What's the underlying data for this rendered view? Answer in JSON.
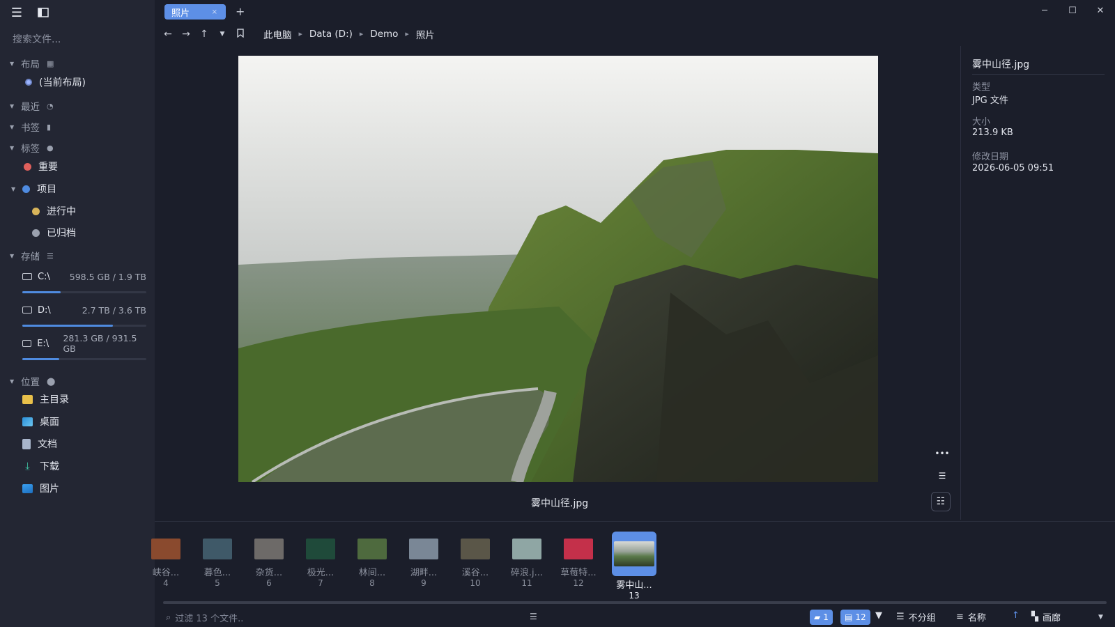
{
  "sidebar": {
    "search_placeholder": "搜索文件...",
    "layout": {
      "label": "布局",
      "current": "(当前布局)"
    },
    "recent": {
      "label": "最近"
    },
    "bookmarks": {
      "label": "书签"
    },
    "tags": {
      "label": "标签",
      "items": [
        {
          "label": "重要",
          "color": "#e0605c"
        },
        {
          "label": "项目",
          "color": "#4f8be0"
        },
        {
          "label": "进行中",
          "color": "#d8b45a"
        },
        {
          "label": "已归档",
          "color": "#9aa0ae"
        }
      ]
    },
    "storage": {
      "label": "存储",
      "drives": [
        {
          "name": "C:\\",
          "size": "598.5 GB / 1.9 TB",
          "usage": 0.31
        },
        {
          "name": "D:\\",
          "size": "2.7 TB / 3.6 TB",
          "usage": 0.73
        },
        {
          "name": "E:\\",
          "size": "281.3 GB / 931.5 GB",
          "usage": 0.3
        }
      ]
    },
    "places": {
      "label": "位置",
      "items": [
        {
          "label": "主目录",
          "icon": "folder-icon"
        },
        {
          "label": "桌面",
          "icon": "desktop-icon"
        },
        {
          "label": "文档",
          "icon": "document-icon"
        },
        {
          "label": "下载",
          "icon": "download-icon"
        },
        {
          "label": "图片",
          "icon": "picture-icon"
        }
      ]
    }
  },
  "tabs": [
    {
      "label": "照片",
      "close": "×"
    }
  ],
  "tab_add": "+",
  "breadcrumb": [
    "此电脑",
    "Data (D:)",
    "Demo",
    "照片"
  ],
  "viewer": {
    "caption": "雾中山径.jpg"
  },
  "info": {
    "filename": "雾中山径.jpg",
    "type_label": "类型",
    "type_value": "JPG 文件",
    "size_label": "大小",
    "size_value": "213.9 KB",
    "modified_label": "修改日期",
    "modified_value": "2026-06-05 09:51"
  },
  "filmstrip": [
    {
      "name": "峡谷...",
      "num": "4",
      "color": "#8a4a2e"
    },
    {
      "name": "暮色...",
      "num": "5",
      "color": "#3f5968"
    },
    {
      "name": "杂货...",
      "num": "6",
      "color": "#6d6a68"
    },
    {
      "name": "极光...",
      "num": "7",
      "color": "#1f4a3a"
    },
    {
      "name": "林间...",
      "num": "8",
      "color": "#4e6a3e"
    },
    {
      "name": "湖畔...",
      "num": "9",
      "color": "#7a8796"
    },
    {
      "name": "溪谷...",
      "num": "10",
      "color": "#5a5648"
    },
    {
      "name": "碎浪.j...",
      "num": "11",
      "color": "#8fa6a4"
    },
    {
      "name": "草莓特...",
      "num": "12",
      "color": "#c4304a"
    },
    {
      "name": "雾中山...",
      "num": "13",
      "color": "#5a7a4a",
      "selected": true
    }
  ],
  "statusbar": {
    "filter_placeholder": "过滤 13 个文件..",
    "folders_count": "1",
    "files_count": "12",
    "group": "不分组",
    "sort": "名称",
    "view": "画廊"
  }
}
